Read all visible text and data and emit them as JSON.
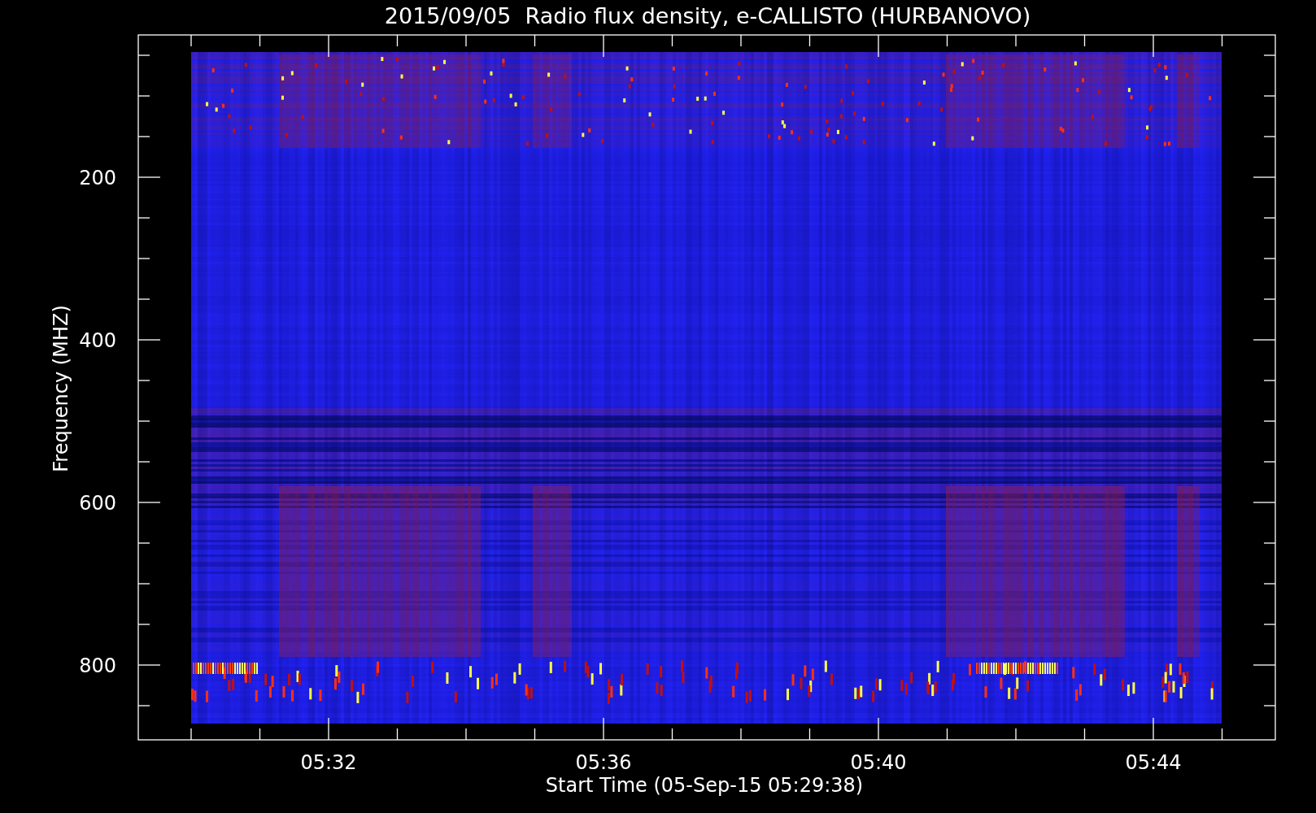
{
  "title": "2015/09/05  Radio flux density, e-CALLISTO (HURBANOVO)",
  "y_axis": {
    "label": "Frequency (MHZ)",
    "ticks": [
      "200",
      "400",
      "600",
      "800"
    ]
  },
  "x_axis": {
    "label": "Start Time (05-Sep-15 05:29:38)",
    "ticks": [
      "05:32",
      "05:36",
      "05:40",
      "05:44"
    ]
  }
}
